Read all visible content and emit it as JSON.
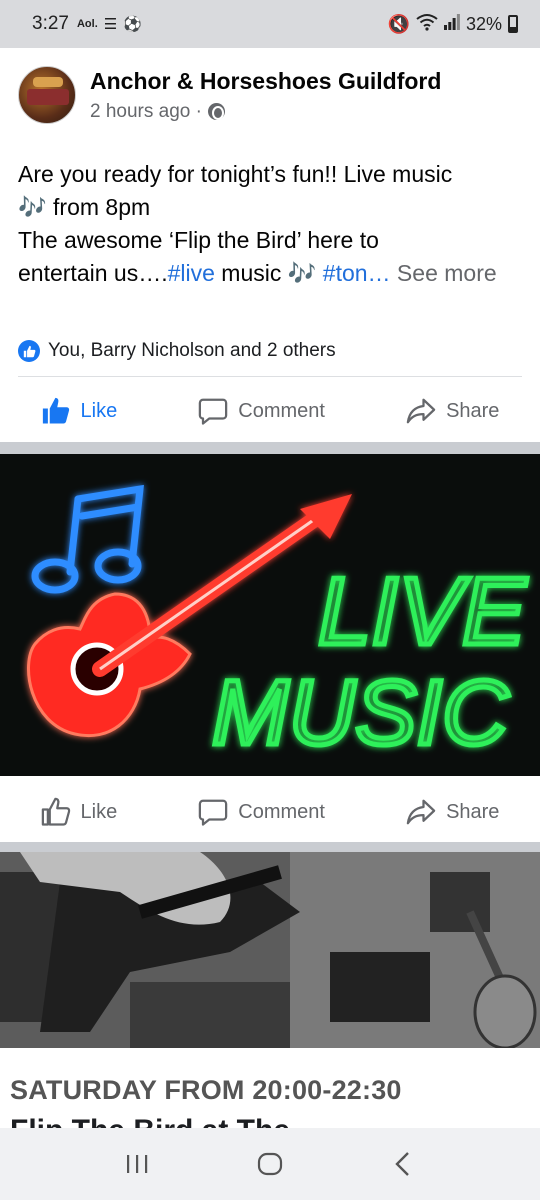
{
  "status_bar": {
    "time": "3:27",
    "carrier_label": "Aol.",
    "battery": "32%"
  },
  "post": {
    "page_name": "Anchor & Horseshoes Guildford",
    "time_ago": "2 hours ago ·",
    "text_line1": "Are you ready for tonight’s fun!! Live music",
    "text_line2": "🎶 from 8pm",
    "text_line3": "The awesome ‘Flip the Bird’ here to",
    "text_line4_a": "entertain us….",
    "hashtag_live": "#live",
    "text_line4_b": " music  🎶 ",
    "hashtag_ton": "#ton…",
    "see_more": " See more",
    "reactions_text": "You, Barry Nicholson and 2 others"
  },
  "actions": {
    "like": "Like",
    "comment": "Comment",
    "share": "Share"
  },
  "neon_sign": {
    "line1": "LIVE",
    "line2": "MUSIC"
  },
  "event_card": {
    "heading": "SATURDAY FROM 20:00-22:30",
    "subheading": "Flip The Bird at The"
  },
  "colors": {
    "fb_blue": "#1877f2",
    "hashtag_blue": "#216fdb",
    "gray_text": "#65676b",
    "neon_green": "#2df05a",
    "neon_red": "#ff3b2f",
    "neon_blue": "#2f8dff"
  }
}
